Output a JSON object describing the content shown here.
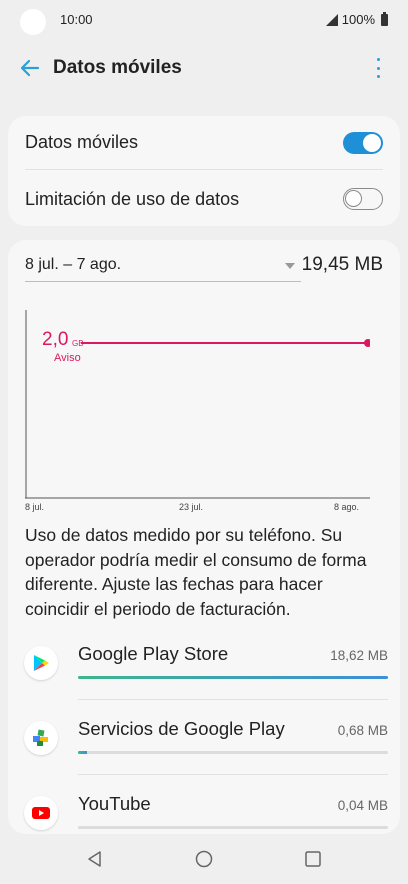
{
  "status": {
    "time": "10:00",
    "battery": "100%"
  },
  "header": {
    "title": "Datos móviles"
  },
  "settings": {
    "mobile_data": {
      "label": "Datos móviles",
      "enabled": true
    },
    "data_limit": {
      "label": "Limitación de uso de datos",
      "enabled": false
    }
  },
  "usage": {
    "period": "8 jul. – 7 ago.",
    "total": "19,45 MB",
    "warning": {
      "value": "2,0",
      "unit": "GB",
      "label": "Aviso"
    },
    "ticks": [
      "8 jul.",
      "23 jul.",
      "8 ago."
    ],
    "note": "Uso de datos medido por su teléfono. Su operador podría medir el consumo de forma diferente. Ajuste las fechas para hacer coincidir el periodo de facturación."
  },
  "apps": [
    {
      "name": "Google Play Store",
      "size": "18,62 MB",
      "fraction": 1.0,
      "icon": "google-play-store-icon"
    },
    {
      "name": "Servicios de Google Play",
      "size": "0,68 MB",
      "fraction": 0.03,
      "icon": "google-play-services-icon"
    },
    {
      "name": "YouTube",
      "size": "0,04 MB",
      "fraction": 0.0,
      "icon": "youtube-icon"
    }
  ],
  "colors": {
    "accent": "#1f8fd6",
    "warning": "#d81b60",
    "background": "#efefef",
    "card": "#f7f7f7"
  }
}
